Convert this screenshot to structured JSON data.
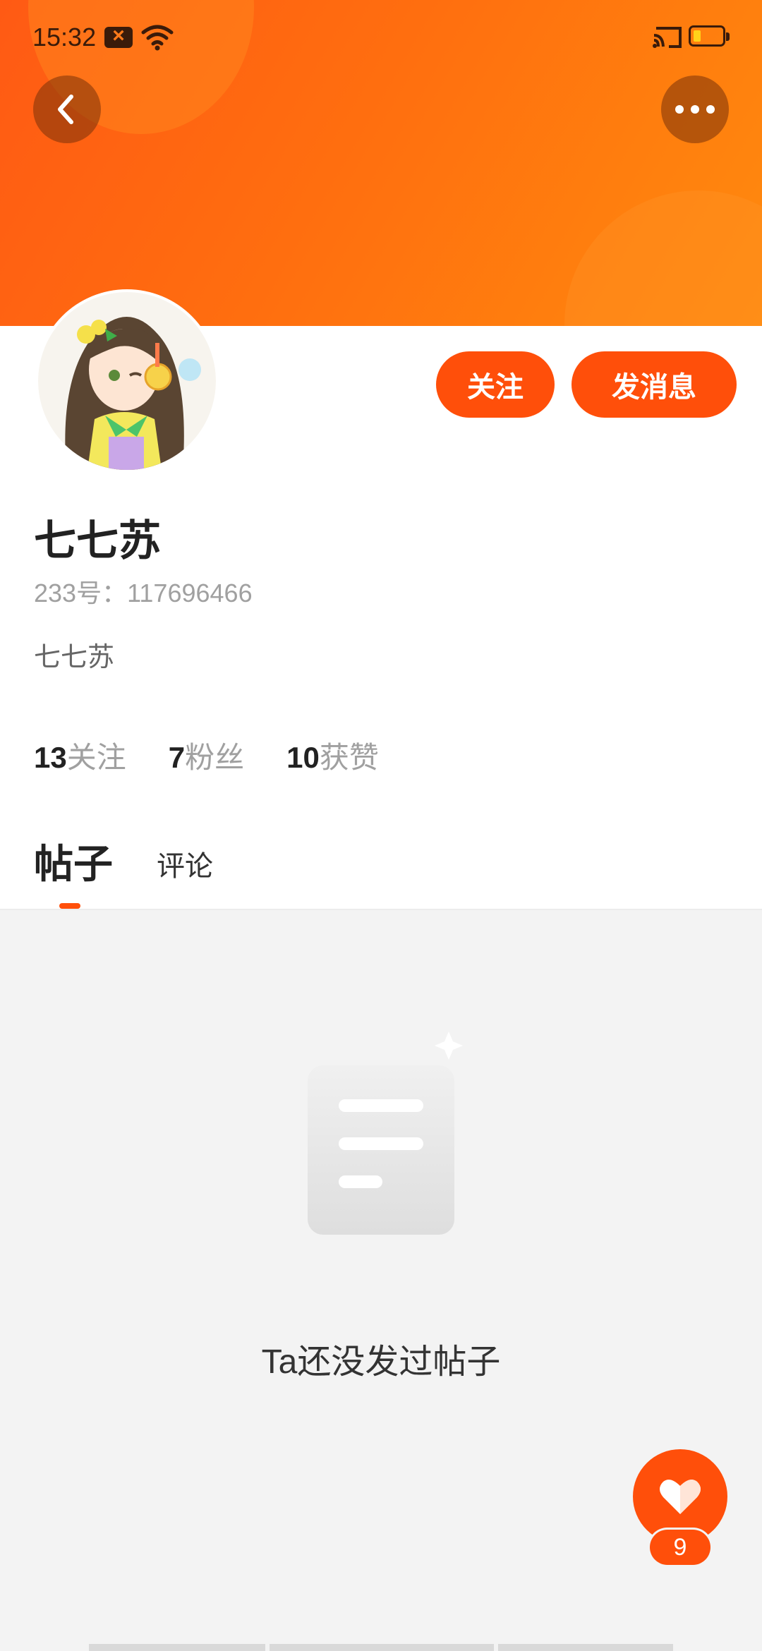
{
  "status_bar": {
    "time": "15:32",
    "icons": [
      "notification-x-icon",
      "wifi-icon",
      "cast-icon",
      "battery-icon"
    ]
  },
  "header": {
    "back_icon": "chevron-left-icon",
    "more_icon": "more-dots-icon",
    "accent_color": "#ff5a14"
  },
  "profile": {
    "name": "七七苏",
    "uid": "233号：117696466",
    "bio": "七七苏",
    "follow_label": "关注",
    "message_label": "发消息",
    "stats": [
      {
        "value": "13",
        "label": "关注"
      },
      {
        "value": "7",
        "label": "粉丝"
      },
      {
        "value": "10",
        "label": "获赞"
      }
    ]
  },
  "tabs": {
    "items": [
      {
        "label": "帖子",
        "active": true
      },
      {
        "label": "评论",
        "active": false
      }
    ]
  },
  "empty_state": {
    "icon": "document-icon",
    "message": "Ta还没发过帖子"
  },
  "like_fab": {
    "icon": "heart-icon",
    "count": "9"
  }
}
